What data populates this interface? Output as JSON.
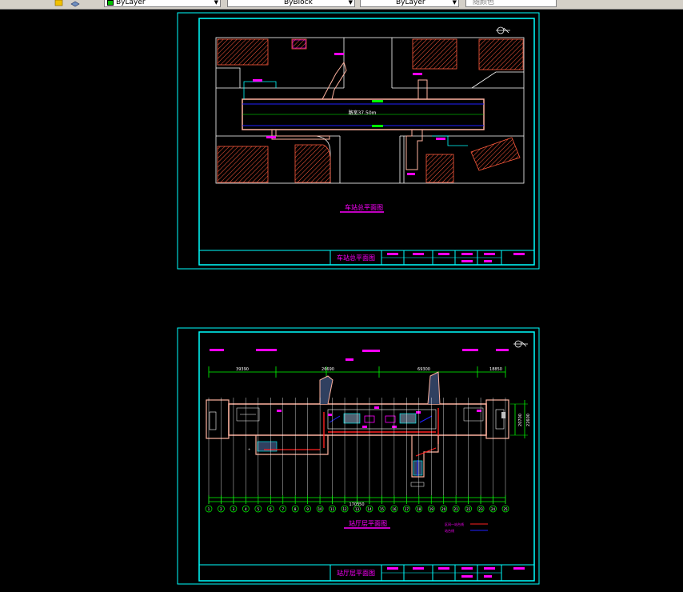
{
  "toolbar": {
    "layer_combo": "ByLayer",
    "linetype_combo": "ByBlock",
    "lineweight_combo": "ByLayer",
    "plotstyle_combo": "随颜色"
  },
  "sheet1": {
    "road_label": "路宽37.50m",
    "caption": "车站总平面图",
    "title_cell": "车站总平面图"
  },
  "sheet2": {
    "caption": "站厅层平面图",
    "title_cell": "站厅层平面图",
    "dim_top": [
      "39390",
      "26690",
      "69300",
      "18850"
    ],
    "total_dim": "170350",
    "width_dim_a": "20700",
    "width_dim_b": "22600",
    "axis_numbers": [
      "1",
      "2",
      "3",
      "4",
      "5",
      "6",
      "7",
      "8",
      "9",
      "10",
      "11",
      "12",
      "13",
      "14",
      "15",
      "16",
      "17",
      "18",
      "19",
      "20",
      "21",
      "22",
      "23",
      "24",
      "25"
    ],
    "legend": [
      "区间一站台线",
      "站台线"
    ]
  },
  "colors": {
    "frame": "#00ffff",
    "magenta": "#ff00ff",
    "hatch": "#ff5a3c",
    "structure": "#ffb3a0",
    "dim_green": "#00ff00",
    "blue": "#2020ff",
    "red": "#ff2020"
  }
}
